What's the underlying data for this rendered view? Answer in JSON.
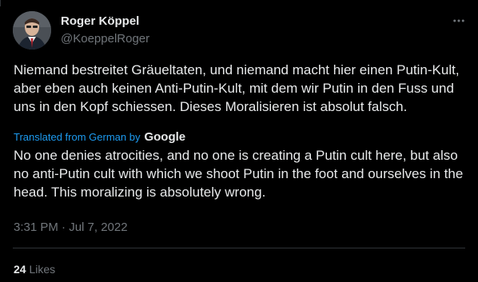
{
  "author": {
    "display_name": "Roger Köppel",
    "handle": "@KoeppelRoger"
  },
  "tweet": {
    "original_text": "Niemand bestreitet Gräueltaten, und niemand macht hier einen Putin-Kult, aber eben auch keinen Anti-Putin-Kult, mit dem wir Putin in den Fuss und uns in den Kopf schiessen. Dieses Moralisieren ist absolut falsch.",
    "translated_label": "Translated from German by",
    "translator": "Google",
    "translated_text": "No one denies atrocities, and no one is creating a Putin cult here, but also no anti-Putin cult with which we shoot Putin in the foot and ourselves in the head. This moralizing is absolutely wrong.",
    "timestamp": "3:31 PM · Jul 7, 2022"
  },
  "stats": {
    "likes_count": "24",
    "likes_label": "Likes"
  },
  "icons": {
    "more": "more-horizontal-icon",
    "avatar": "avatar"
  },
  "colors": {
    "background": "#000000",
    "text": "#e7e9ea",
    "muted": "#71767b",
    "link": "#1d9bf0",
    "divider": "#2f3336"
  }
}
